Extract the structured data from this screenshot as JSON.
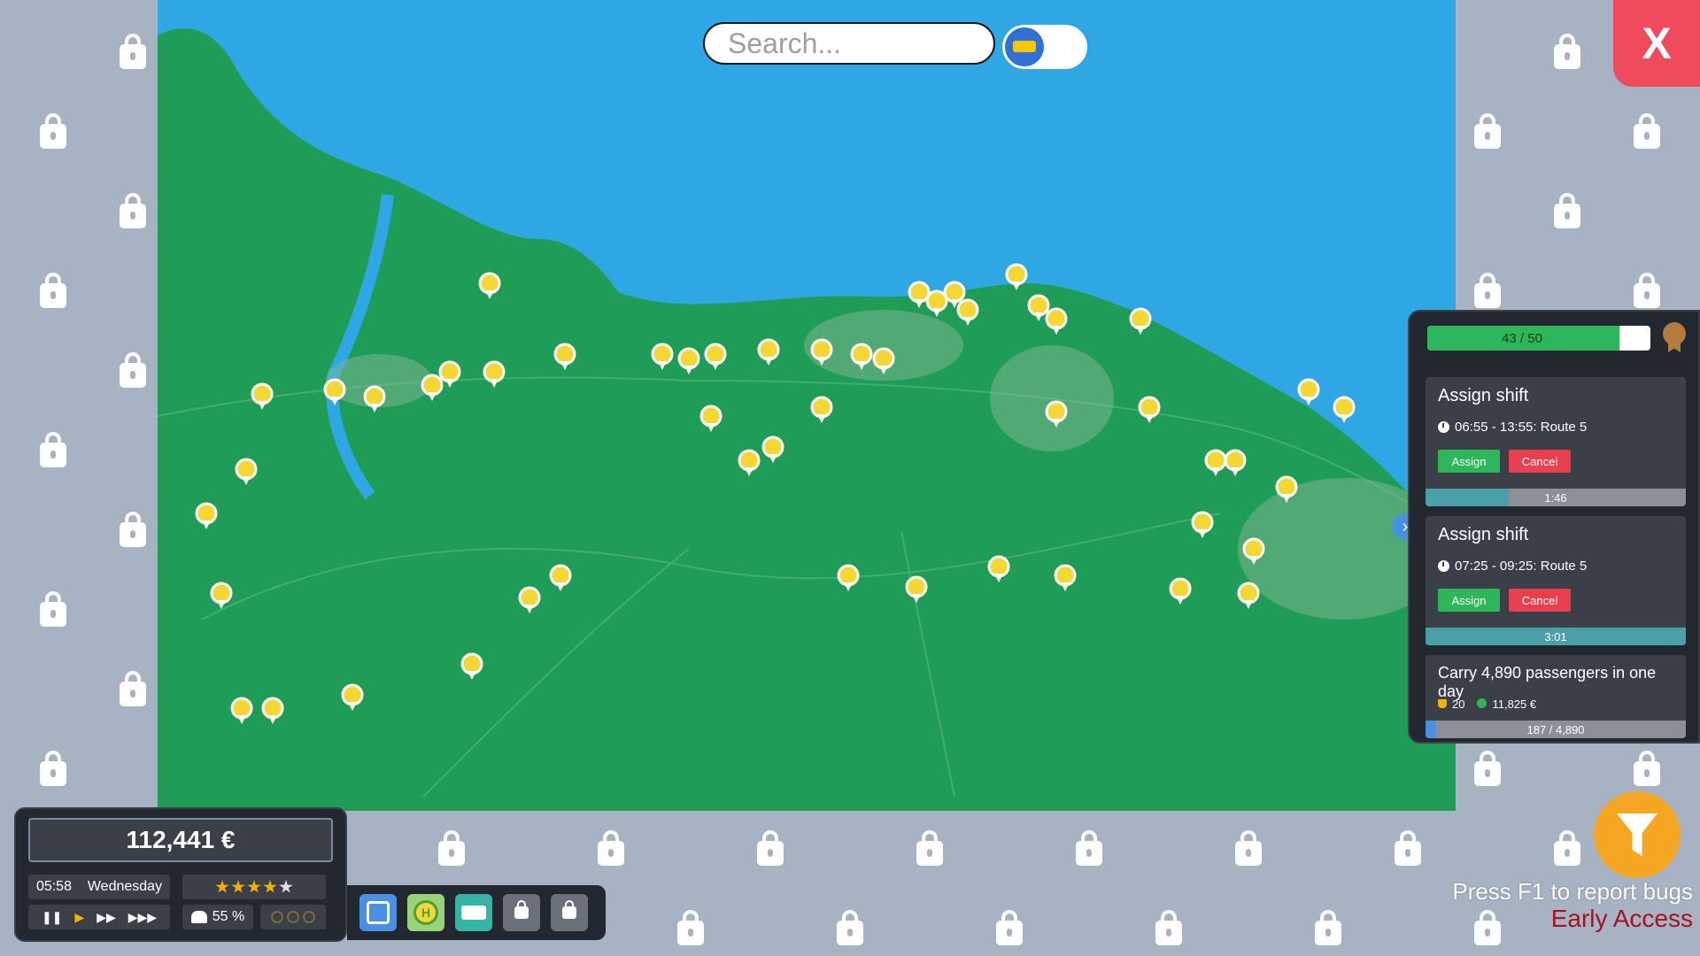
{
  "search": {
    "placeholder": "Search..."
  },
  "close_label": "X",
  "panel": {
    "progress": {
      "value": 43,
      "max": 50,
      "label": "43 / 50",
      "fraction": 0.86
    },
    "collapse_arrow": "›",
    "tasks": [
      {
        "title": "Assign shift",
        "detail": "06:55 - 13:55: Route 5",
        "assign": "Assign",
        "cancel": "Cancel",
        "timer": "1:46",
        "timer_fraction": 0.32
      },
      {
        "title": "Assign shift",
        "detail": "07:25 - 09:25: Route 5",
        "assign": "Assign",
        "cancel": "Cancel",
        "timer": "3:01",
        "timer_fraction": 1.0
      }
    ],
    "goal": {
      "title": "Carry 4,890 passengers in one day",
      "reward_points": "20",
      "reward_money": "11,825 €",
      "progress_label": "187 / 4,890",
      "fraction": 0.038
    }
  },
  "hud": {
    "money": "112,441 €",
    "time": "05:58",
    "day": "Wednesday",
    "stars": 4,
    "stars_max": 5,
    "satisfaction": "55 %",
    "speed_controls": [
      "pause",
      "play",
      "fast",
      "faster"
    ]
  },
  "toolbar": {
    "tools": [
      "route-tool",
      "stop-tool",
      "bus-tool",
      "locked-tool-1",
      "locked-tool-2"
    ]
  },
  "footer": {
    "bug_text": "Press F1 to report bugs",
    "early_access": "Early Access"
  },
  "colors": {
    "map_sea": "#2ea7e4",
    "map_land": "#1f9d57",
    "panel_bg": "#232830",
    "accent_green": "#2db65a",
    "accent_red": "#e8404f",
    "close_red": "#f04b5c",
    "filter_orange": "#f5a623"
  }
}
